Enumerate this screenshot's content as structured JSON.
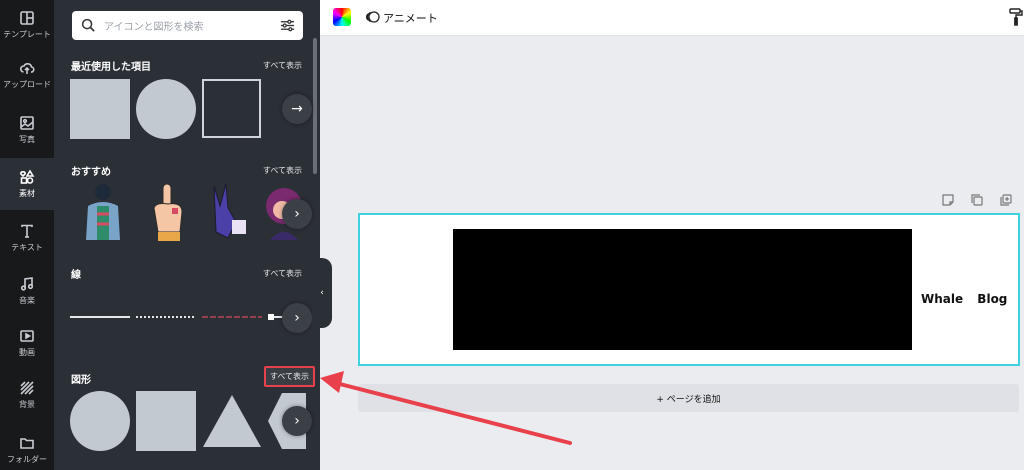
{
  "rail": {
    "items": [
      {
        "label": "テンプレート",
        "icon": "layout-icon"
      },
      {
        "label": "アップロード",
        "icon": "upload-cloud-icon"
      },
      {
        "label": "写真",
        "icon": "photo-icon"
      },
      {
        "label": "素材",
        "icon": "elements-icon",
        "active": true
      },
      {
        "label": "テキスト",
        "icon": "text-icon"
      },
      {
        "label": "音楽",
        "icon": "music-icon"
      },
      {
        "label": "動画",
        "icon": "video-icon"
      },
      {
        "label": "背景",
        "icon": "background-icon"
      },
      {
        "label": "フォルダー",
        "icon": "folder-icon"
      }
    ]
  },
  "search": {
    "placeholder": "アイコンと図形を検索"
  },
  "sections": {
    "recent": {
      "title": "最近使用した項目",
      "see_all": "すべて表示"
    },
    "recommended": {
      "title": "おすすめ",
      "see_all": "すべて表示"
    },
    "lines": {
      "title": "線",
      "see_all": "すべて表示"
    },
    "shapes": {
      "title": "図形",
      "see_all": "すべて表示"
    }
  },
  "topbar": {
    "animate_label": "アニメート"
  },
  "canvas": {
    "logo_text": "Whale Blog",
    "add_page_label": "+ ページを追加"
  },
  "colors": {
    "rail_bg": "#18191b",
    "panel_bg": "#2b2f36",
    "shape_fill": "#c3c9d1",
    "selection": "#3ed2e0",
    "annotation": "#e8414b"
  }
}
